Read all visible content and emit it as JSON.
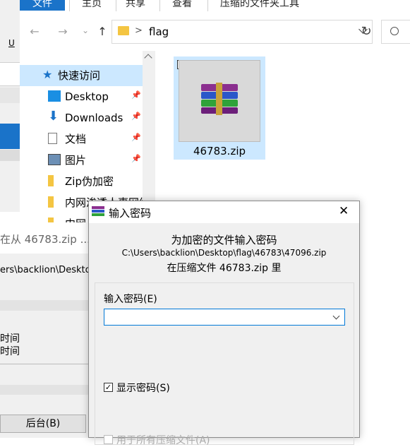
{
  "ribbon": {
    "tabs": [
      "文件",
      "主页",
      "共享",
      "查看",
      "压缩的文件夹工具"
    ]
  },
  "nav": {
    "back_icon": "←",
    "forward_icon": "→",
    "history_icon": "⌄",
    "up_icon": "↑",
    "refresh_icon": "↻"
  },
  "address": {
    "separator": ">",
    "folder": "flag"
  },
  "sidebar": {
    "quick_access": "快速访问",
    "items": [
      {
        "label": "Desktop",
        "pinned": true
      },
      {
        "label": "Downloads",
        "pinned": true
      },
      {
        "label": "文档",
        "pinned": true
      },
      {
        "label": "图片",
        "pinned": true
      },
      {
        "label": "Zip伪加密",
        "pinned": false
      },
      {
        "label": "内网渗透人事网络",
        "pinned": false
      },
      {
        "label": "内网",
        "pinned": false
      }
    ]
  },
  "content": {
    "file": {
      "name": "46783.zip",
      "checked": true
    }
  },
  "left_fragments": {
    "underline_letter": "U"
  },
  "bg_window": {
    "title": "在从 46783.zip ...",
    "path": "ers\\backlion\\Desktop\\f",
    "time1": "时间",
    "time2": "时间",
    "background_button": "后台(B)"
  },
  "dialog": {
    "title": "输入密码",
    "close": "✕",
    "heading": "为加密的文件输入密码",
    "filepath": "C:\\Users\\backlion\\Desktop\\flag\\46783\\47096.zip",
    "archive_line": "在压缩文件 46783.zip 里",
    "password_label": "输入密码(E)",
    "password_value": "",
    "show_password_label": "显示密码(S)",
    "show_password_checked": true,
    "apply_all_label": "用于所有压缩文件(A)"
  },
  "colors": {
    "accent": "#1a73c9",
    "selection": "#cce8ff",
    "dialog_bg": "#f0f0f0",
    "focus_border": "#0078d7"
  }
}
